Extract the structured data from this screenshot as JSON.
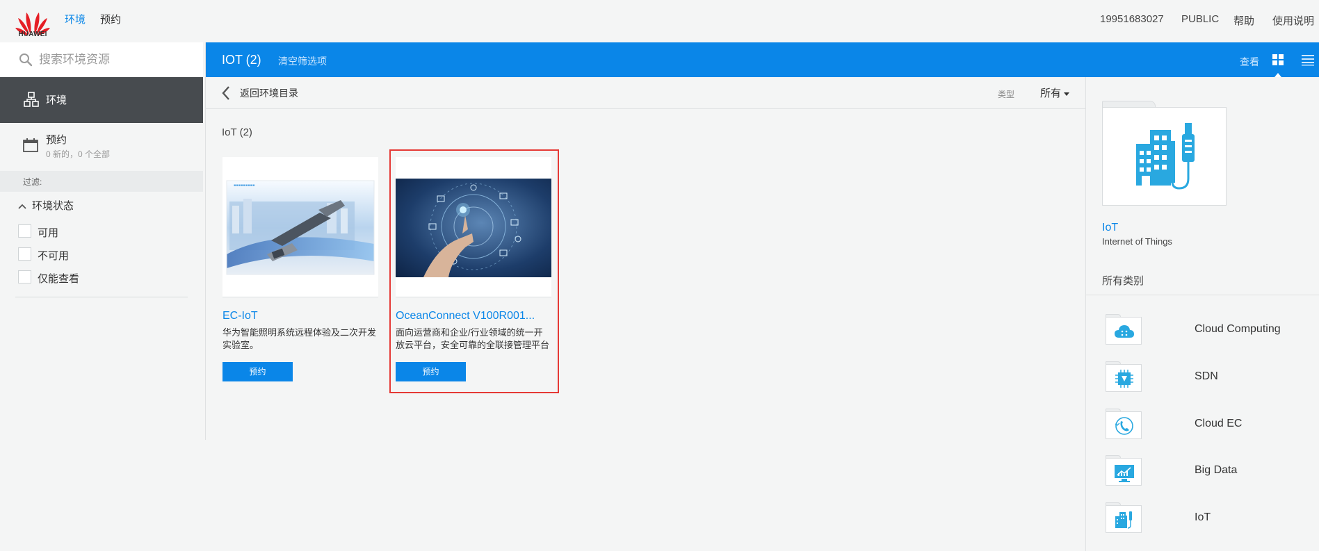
{
  "brand": {
    "logo_text": "HUAWEI"
  },
  "topnav": {
    "items": [
      "环境",
      "预约"
    ]
  },
  "user_menu": {
    "phone": "19951683027",
    "project": "PUBLIC",
    "help": "帮助",
    "manual": "使用说明"
  },
  "sidebar": {
    "search_placeholder": "搜索环境资源",
    "nav_env": "环境",
    "nav_booking": "预约",
    "booking_sub": "0 新的，0 个全部",
    "filter_label": "过滤:",
    "status_heading": "环境状态",
    "filters": [
      "可用",
      "不可用",
      "仅能查看"
    ]
  },
  "header": {
    "title": "IOT (2)",
    "clear_filters": "清空筛选项",
    "view_label": "查看"
  },
  "subbar": {
    "back": "返回环境目录",
    "type_label": "类型",
    "type_value": "所有"
  },
  "content": {
    "section_title": "IoT (2)",
    "cards": [
      {
        "name": "EC-IoT",
        "desc": "华为智能照明系统远程体验及二次开发实验室。",
        "button": "预约"
      },
      {
        "name": "OceanConnect V100R001...",
        "desc": "面向运营商和企业/行业领域的统一开放云平台，安全可靠的全联接管理平台",
        "button": "预约"
      }
    ]
  },
  "right_panel": {
    "name": "IoT",
    "subtitle": "Internet of Things",
    "all_categories": "所有类别",
    "categories": [
      {
        "label": "Cloud Computing",
        "icon": "cloud-icon"
      },
      {
        "label": "SDN",
        "icon": "chip-icon"
      },
      {
        "label": "Cloud EC",
        "icon": "phone-icon"
      },
      {
        "label": "Big Data",
        "icon": "chart-icon"
      },
      {
        "label": "IoT",
        "icon": "iot-building-icon"
      }
    ]
  },
  "colors": {
    "accent": "#0a86e8",
    "sidebar_active": "#474b4f",
    "highlight": "#e53935"
  }
}
